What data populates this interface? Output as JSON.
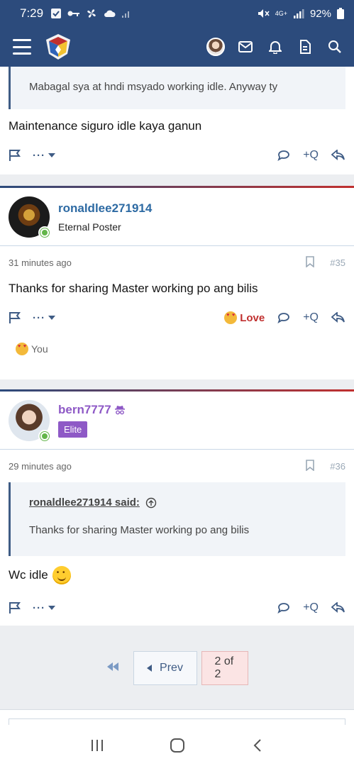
{
  "status": {
    "time": "7:29",
    "battery": "92%",
    "network": "4G+"
  },
  "posts": [
    {
      "quote": "Mabagal sya at hndi msyado working idle. Anyway ty",
      "text": "Maintenance siguro idle kaya ganun",
      "reply_label": "+Q"
    },
    {
      "username": "ronaldlee271914",
      "user_title": "Eternal Poster",
      "time": "31 minutes ago",
      "number": "#35",
      "text": "Thanks for sharing Master working po ang bilis",
      "reaction_label": "Love",
      "reply_label": "+Q",
      "reacted_by": "You"
    },
    {
      "username": "bern7777",
      "user_badge": "Elite",
      "time": "29 minutes ago",
      "number": "#36",
      "quote_author": "ronaldlee271914 said:",
      "quote": "Thanks for sharing Master working po ang bilis",
      "text": "Wc idle",
      "reply_label": "+Q"
    }
  ],
  "pager": {
    "prev": "Prev",
    "current": "2 of 2"
  },
  "colors": {
    "brand": "#2c4b7c",
    "accent": "#c0302f",
    "link": "#2d6aa3",
    "elite": "#8e59c6"
  }
}
